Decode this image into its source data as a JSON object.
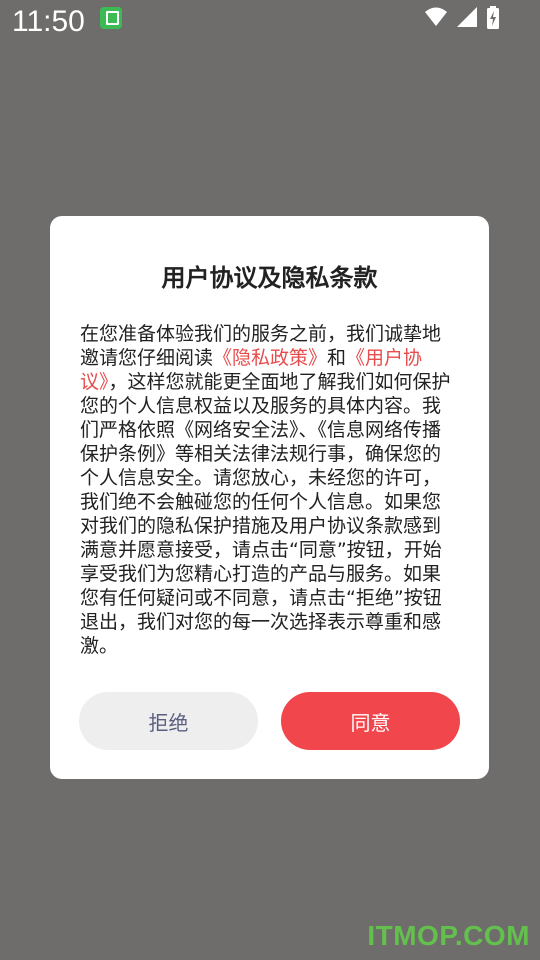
{
  "status_bar": {
    "time": "11:50",
    "icons": [
      "app-notification-icon",
      "wifi-icon",
      "signal-icon",
      "battery-charging-icon"
    ]
  },
  "dialog": {
    "title": "用户协议及隐私条款",
    "body": {
      "p1_a": "在您准备体验我们的服务之前，我们诚挚地邀请您仔细阅读",
      "privacy_link": "《隐私政策》",
      "p1_b": "和",
      "agreement_link": "《用户协议》",
      "p1_c": "，这样您就能更全面地了解我们如何保护您的个人信息权益以及服务的具体内容。我们严格依照《网络安全法》、《信息网络传播保护条例》等相关法律法规行事，确保您的个人信息安全。请您放心，未经您的许可，我们绝不会触碰您的任何个人信息。如果您对我们的隐私保护措施及用户协议条款感到满意并愿意接受，请点击“同意”按钮，开始享受我们为您精心打造的产品与服务。如果您有任何疑问或不同意，请点击“拒绝”按钮退出，我们对您的每一次选择表示尊重和感激。"
    },
    "reject_label": "拒绝",
    "agree_label": "同意"
  },
  "colors": {
    "overlay": "#6f6d6c",
    "link": "#e84c4c",
    "agree_button": "#f2464d",
    "reject_button": "#eeeeee"
  },
  "watermark": "ITMOP.COM"
}
